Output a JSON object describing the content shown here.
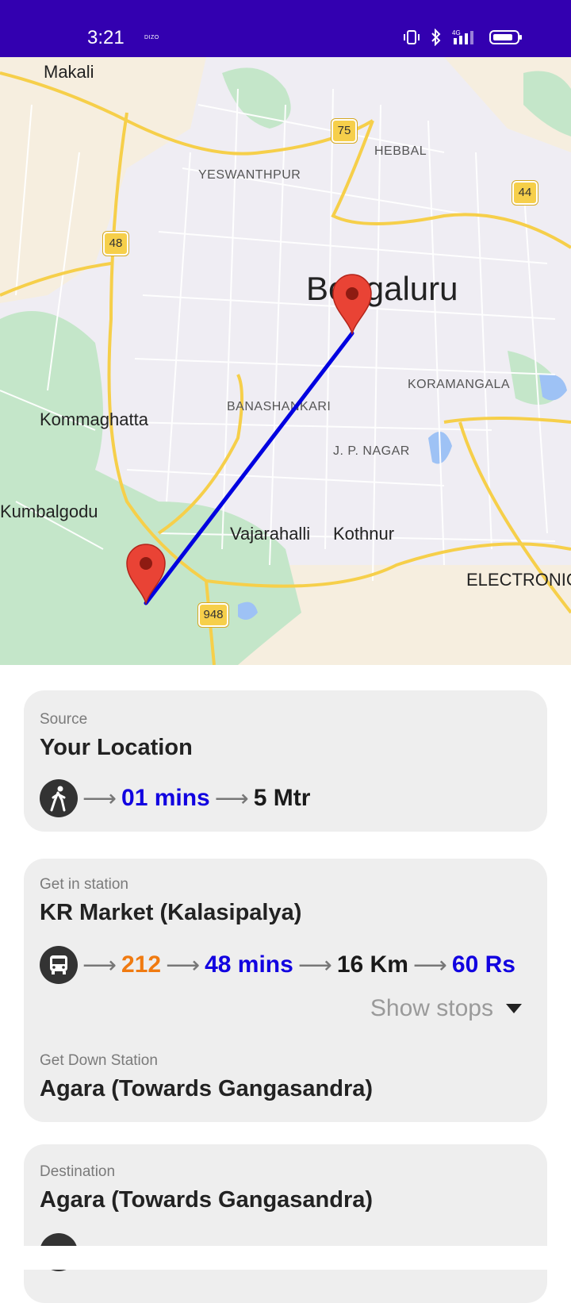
{
  "status_bar": {
    "time": "3:21",
    "carrier": "DIZO"
  },
  "map": {
    "labels": {
      "makali": "Makali",
      "hebbal": "HEBBAL",
      "yeswanthpur": "YESWANTHPUR",
      "bengaluru": "Bengaluru",
      "koramangala": "KORAMANGALA",
      "banashankari": "BANASHANKARI",
      "kommaghatta": "Kommaghatta",
      "jp_nagar": "J. P. NAGAR",
      "kumbalgodu": "Kumbalgodu",
      "vajarahalli": "Vajarahalli",
      "kothnur": "Kothnur",
      "electronic": "ELECTRONIC"
    },
    "shields": {
      "s75": "75",
      "s44": "44",
      "s48": "48",
      "s948": "948"
    },
    "colors": {
      "route": "#0000E0",
      "marker": "#E94335",
      "park": "#C4E6C9",
      "road": "#F6CF4A"
    }
  },
  "source_card": {
    "label": "Source",
    "title": "Your Location",
    "icon": "walk-icon",
    "time": "01 mins",
    "distance": "5 Mtr"
  },
  "station_card": {
    "label": "Get in station",
    "title": "KR Market (Kalasipalya)",
    "icon": "bus-icon",
    "bus_number": "212",
    "time": "48 mins",
    "distance": "16 Km",
    "fare": "60 Rs",
    "show_stops": "Show stops",
    "down_label": "Get Down Station",
    "down_title": "Agara (Towards Gangasandra)"
  },
  "destination_card": {
    "label": "Destination",
    "title": "Agara (Towards Gangasandra)"
  }
}
